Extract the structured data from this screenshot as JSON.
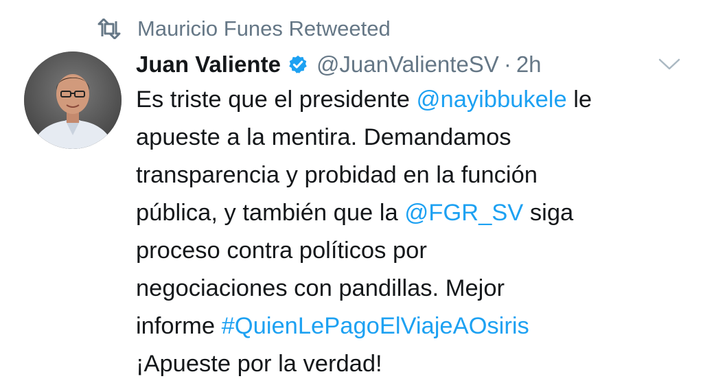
{
  "retweet": {
    "icon": "retweet-icon",
    "text": "Mauricio Funes Retweeted"
  },
  "author": {
    "name": "Juan Valiente",
    "handle": "@JuanValienteSV",
    "separator": "·",
    "time": "2h",
    "verified_icon": "verified-badge-icon"
  },
  "tweet": {
    "lines": [
      [
        "Es triste que el presidente ",
        "@nayibbukele",
        " le"
      ],
      [
        "apueste a la mentira. Demandamos"
      ],
      [
        "transparencia y probidad en la función"
      ],
      [
        "pública, y también que la ",
        "@FGR_SV",
        " siga"
      ],
      [
        "proceso contra políticos por"
      ],
      [
        "negociaciones con pandillas. Mejor"
      ],
      [
        "informe ",
        "#QuienLePagoElViajeAOsiris"
      ],
      [
        "¡Apueste por la verdad!"
      ]
    ]
  },
  "colors": {
    "link": "#1da1f2",
    "secondary_text": "#657786",
    "primary_text": "#14171a"
  }
}
